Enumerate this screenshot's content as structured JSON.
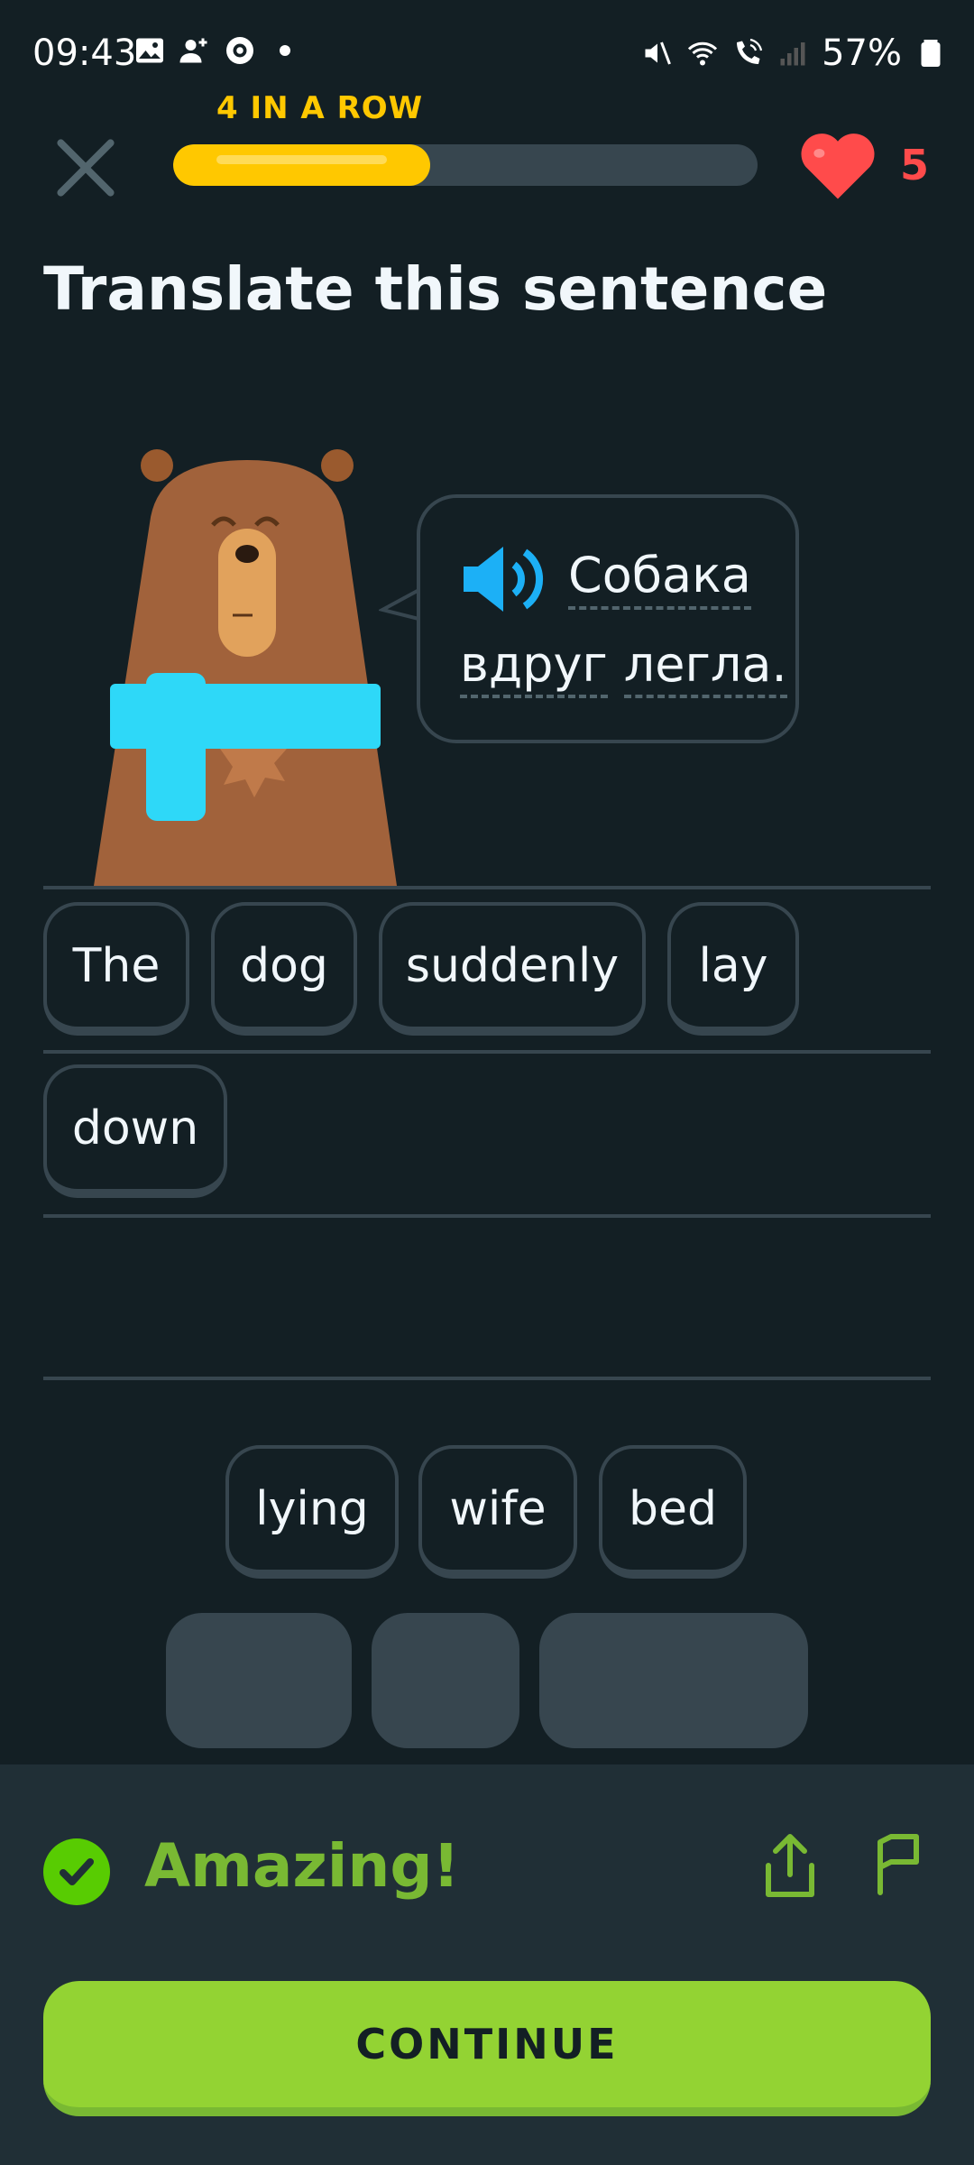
{
  "status_bar": {
    "time": "09:43",
    "battery": "57%",
    "left_icons": [
      "gallery-icon",
      "add-contact-icon",
      "record-icon",
      "dot-icon"
    ],
    "right_icons": [
      "mute-icon",
      "wifi-icon",
      "wifi-calling-icon",
      "signal-icon",
      "battery-icon"
    ]
  },
  "header": {
    "streak_label": "4 IN A ROW",
    "progress": 0.44,
    "hearts": "5"
  },
  "prompt": {
    "title": "Translate this sentence",
    "sentence_words": [
      "Собака",
      "вдруг",
      "легла."
    ]
  },
  "answer_chips": [
    "The",
    "dog",
    "suddenly",
    "lay",
    "down"
  ],
  "bank_chips": [
    "lying",
    "wife",
    "bed"
  ],
  "footer": {
    "result_text": "Amazing!",
    "continue_label": "CONTINUE"
  },
  "colors": {
    "background": "#131F24",
    "streak": "#FFC800",
    "heart": "#FF4B4B",
    "speaker": "#1CB0F6",
    "success": "#79B933",
    "continue_button": "#93D333"
  }
}
